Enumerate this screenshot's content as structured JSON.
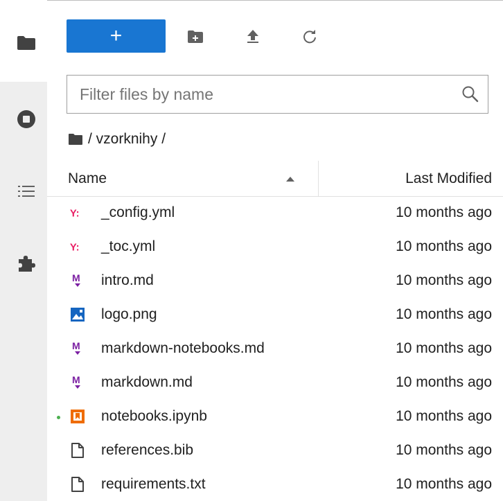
{
  "toolbar": {
    "new_label": "+",
    "new_folder_icon": "new-folder-icon",
    "upload_icon": "upload-icon",
    "refresh_icon": "refresh-icon"
  },
  "filter": {
    "placeholder": "Filter files by name",
    "value": ""
  },
  "breadcrumb": {
    "path": "/ vzorknihy /"
  },
  "columns": {
    "name": "Name",
    "last_modified": "Last Modified"
  },
  "files": [
    {
      "name": "_config.yml",
      "modified": "10 months ago",
      "icon": "yaml-icon",
      "running": false
    },
    {
      "name": "_toc.yml",
      "modified": "10 months ago",
      "icon": "yaml-icon",
      "running": false
    },
    {
      "name": "intro.md",
      "modified": "10 months ago",
      "icon": "markdown-icon",
      "running": false
    },
    {
      "name": "logo.png",
      "modified": "10 months ago",
      "icon": "image-icon",
      "running": false
    },
    {
      "name": "markdown-notebooks.md",
      "modified": "10 months ago",
      "icon": "markdown-icon",
      "running": false
    },
    {
      "name": "markdown.md",
      "modified": "10 months ago",
      "icon": "markdown-icon",
      "running": false
    },
    {
      "name": "notebooks.ipynb",
      "modified": "10 months ago",
      "icon": "notebook-icon",
      "running": true
    },
    {
      "name": "references.bib",
      "modified": "10 months ago",
      "icon": "file-icon",
      "running": false
    },
    {
      "name": "requirements.txt",
      "modified": "10 months ago",
      "icon": "file-icon",
      "running": false
    }
  ],
  "colors": {
    "accent": "#1976d2",
    "yaml": "#e91e63",
    "markdown": "#7b1fa2",
    "image": "#1565c0",
    "notebook": "#ef6c00",
    "running_dot": "#4caf50"
  }
}
